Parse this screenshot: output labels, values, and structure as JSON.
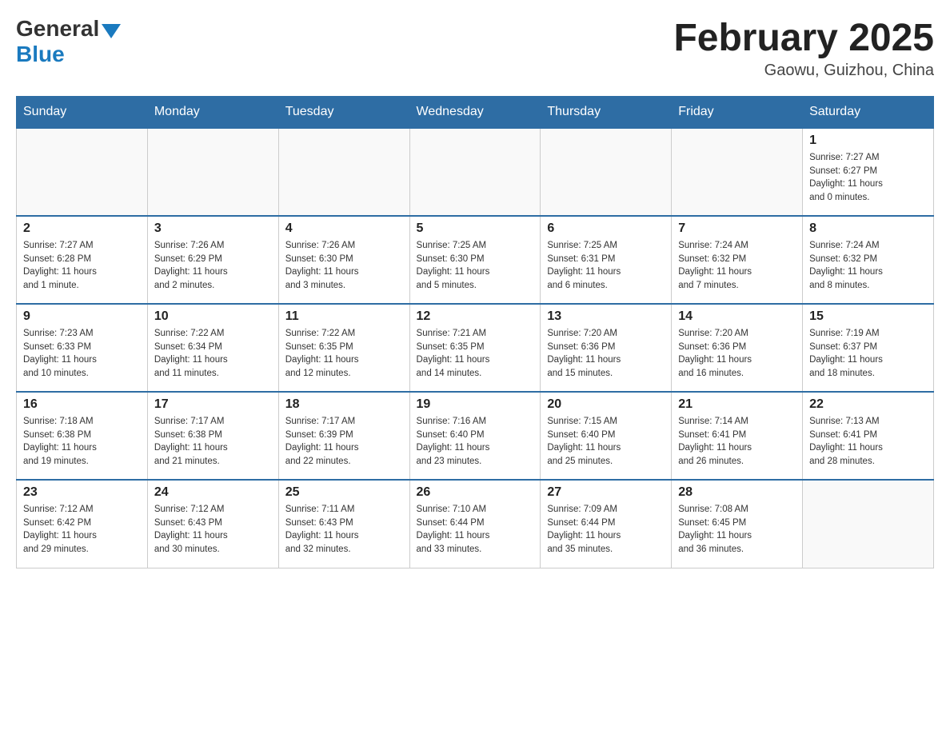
{
  "header": {
    "logo_general": "General",
    "logo_blue": "Blue",
    "month_title": "February 2025",
    "location": "Gaowu, Guizhou, China"
  },
  "days_of_week": [
    "Sunday",
    "Monday",
    "Tuesday",
    "Wednesday",
    "Thursday",
    "Friday",
    "Saturday"
  ],
  "weeks": [
    [
      {
        "day": "",
        "info": ""
      },
      {
        "day": "",
        "info": ""
      },
      {
        "day": "",
        "info": ""
      },
      {
        "day": "",
        "info": ""
      },
      {
        "day": "",
        "info": ""
      },
      {
        "day": "",
        "info": ""
      },
      {
        "day": "1",
        "info": "Sunrise: 7:27 AM\nSunset: 6:27 PM\nDaylight: 11 hours\nand 0 minutes."
      }
    ],
    [
      {
        "day": "2",
        "info": "Sunrise: 7:27 AM\nSunset: 6:28 PM\nDaylight: 11 hours\nand 1 minute."
      },
      {
        "day": "3",
        "info": "Sunrise: 7:26 AM\nSunset: 6:29 PM\nDaylight: 11 hours\nand 2 minutes."
      },
      {
        "day": "4",
        "info": "Sunrise: 7:26 AM\nSunset: 6:30 PM\nDaylight: 11 hours\nand 3 minutes."
      },
      {
        "day": "5",
        "info": "Sunrise: 7:25 AM\nSunset: 6:30 PM\nDaylight: 11 hours\nand 5 minutes."
      },
      {
        "day": "6",
        "info": "Sunrise: 7:25 AM\nSunset: 6:31 PM\nDaylight: 11 hours\nand 6 minutes."
      },
      {
        "day": "7",
        "info": "Sunrise: 7:24 AM\nSunset: 6:32 PM\nDaylight: 11 hours\nand 7 minutes."
      },
      {
        "day": "8",
        "info": "Sunrise: 7:24 AM\nSunset: 6:32 PM\nDaylight: 11 hours\nand 8 minutes."
      }
    ],
    [
      {
        "day": "9",
        "info": "Sunrise: 7:23 AM\nSunset: 6:33 PM\nDaylight: 11 hours\nand 10 minutes."
      },
      {
        "day": "10",
        "info": "Sunrise: 7:22 AM\nSunset: 6:34 PM\nDaylight: 11 hours\nand 11 minutes."
      },
      {
        "day": "11",
        "info": "Sunrise: 7:22 AM\nSunset: 6:35 PM\nDaylight: 11 hours\nand 12 minutes."
      },
      {
        "day": "12",
        "info": "Sunrise: 7:21 AM\nSunset: 6:35 PM\nDaylight: 11 hours\nand 14 minutes."
      },
      {
        "day": "13",
        "info": "Sunrise: 7:20 AM\nSunset: 6:36 PM\nDaylight: 11 hours\nand 15 minutes."
      },
      {
        "day": "14",
        "info": "Sunrise: 7:20 AM\nSunset: 6:36 PM\nDaylight: 11 hours\nand 16 minutes."
      },
      {
        "day": "15",
        "info": "Sunrise: 7:19 AM\nSunset: 6:37 PM\nDaylight: 11 hours\nand 18 minutes."
      }
    ],
    [
      {
        "day": "16",
        "info": "Sunrise: 7:18 AM\nSunset: 6:38 PM\nDaylight: 11 hours\nand 19 minutes."
      },
      {
        "day": "17",
        "info": "Sunrise: 7:17 AM\nSunset: 6:38 PM\nDaylight: 11 hours\nand 21 minutes."
      },
      {
        "day": "18",
        "info": "Sunrise: 7:17 AM\nSunset: 6:39 PM\nDaylight: 11 hours\nand 22 minutes."
      },
      {
        "day": "19",
        "info": "Sunrise: 7:16 AM\nSunset: 6:40 PM\nDaylight: 11 hours\nand 23 minutes."
      },
      {
        "day": "20",
        "info": "Sunrise: 7:15 AM\nSunset: 6:40 PM\nDaylight: 11 hours\nand 25 minutes."
      },
      {
        "day": "21",
        "info": "Sunrise: 7:14 AM\nSunset: 6:41 PM\nDaylight: 11 hours\nand 26 minutes."
      },
      {
        "day": "22",
        "info": "Sunrise: 7:13 AM\nSunset: 6:41 PM\nDaylight: 11 hours\nand 28 minutes."
      }
    ],
    [
      {
        "day": "23",
        "info": "Sunrise: 7:12 AM\nSunset: 6:42 PM\nDaylight: 11 hours\nand 29 minutes."
      },
      {
        "day": "24",
        "info": "Sunrise: 7:12 AM\nSunset: 6:43 PM\nDaylight: 11 hours\nand 30 minutes."
      },
      {
        "day": "25",
        "info": "Sunrise: 7:11 AM\nSunset: 6:43 PM\nDaylight: 11 hours\nand 32 minutes."
      },
      {
        "day": "26",
        "info": "Sunrise: 7:10 AM\nSunset: 6:44 PM\nDaylight: 11 hours\nand 33 minutes."
      },
      {
        "day": "27",
        "info": "Sunrise: 7:09 AM\nSunset: 6:44 PM\nDaylight: 11 hours\nand 35 minutes."
      },
      {
        "day": "28",
        "info": "Sunrise: 7:08 AM\nSunset: 6:45 PM\nDaylight: 11 hours\nand 36 minutes."
      },
      {
        "day": "",
        "info": ""
      }
    ]
  ]
}
